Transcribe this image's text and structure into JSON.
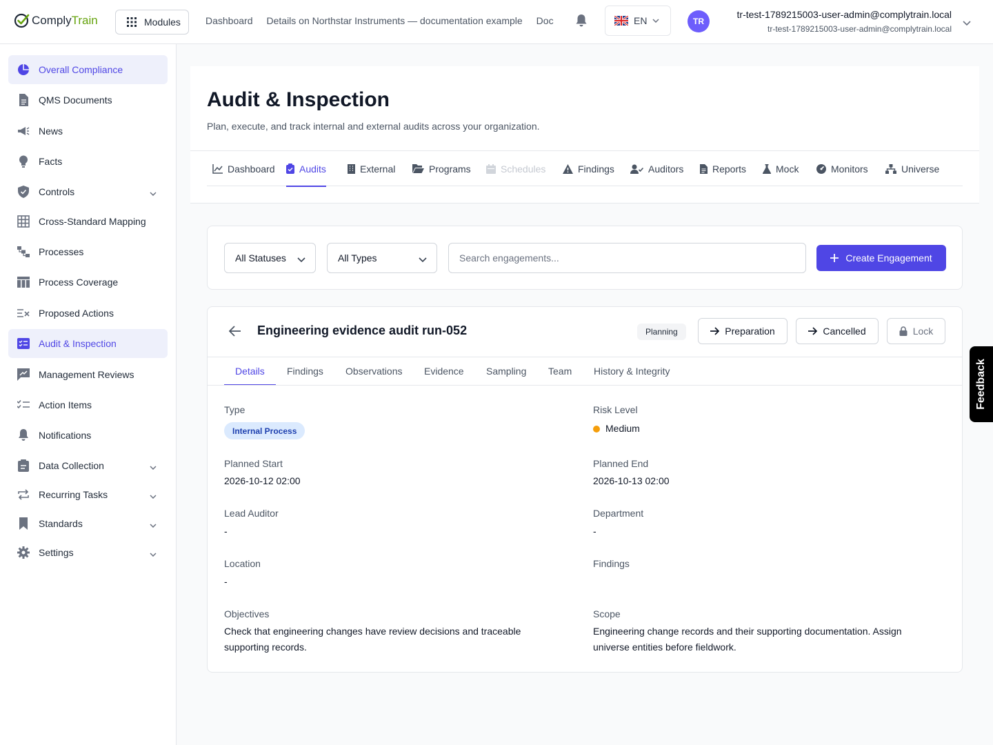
{
  "app": {
    "logo_part1": "Comply",
    "logo_part2": "Train"
  },
  "topbar": {
    "modules_label": "Modules",
    "breadcrumbs": [
      "Dashboard",
      "Details on Northstar Instruments — documentation example",
      "Doc"
    ],
    "language": "EN",
    "avatar_initials": "TR",
    "user_name": "tr-test-1789215003-user-admin@complytrain.local",
    "user_email": "tr-test-1789215003-user-admin@complytrain.local"
  },
  "sidebar": {
    "items": [
      {
        "label": "Overall Compliance",
        "icon": "pie-chart-icon"
      },
      {
        "label": "QMS Documents",
        "icon": "document-icon"
      },
      {
        "label": "News",
        "icon": "megaphone-icon"
      },
      {
        "label": "Facts",
        "icon": "lightbulb-icon"
      },
      {
        "label": "Controls",
        "icon": "shield-icon"
      },
      {
        "label": "Cross-Standard Mapping",
        "icon": "grid-icon"
      },
      {
        "label": "Processes",
        "icon": "flow-icon"
      },
      {
        "label": "Process Coverage",
        "icon": "table-icon"
      },
      {
        "label": "Proposed Actions",
        "icon": "checklist-x-icon"
      },
      {
        "label": "Audit & Inspection",
        "icon": "audit-list-icon"
      },
      {
        "label": "Management Reviews",
        "icon": "chat-chart-icon"
      },
      {
        "label": "Action Items",
        "icon": "checklist-icon"
      },
      {
        "label": "Notifications",
        "icon": "bell-icon"
      },
      {
        "label": "Data Collection",
        "icon": "clipboard-icon"
      },
      {
        "label": "Recurring Tasks",
        "icon": "repeat-icon"
      },
      {
        "label": "Standards",
        "icon": "bookmark-icon"
      },
      {
        "label": "Settings",
        "icon": "gear-icon"
      }
    ]
  },
  "page": {
    "title": "Audit & Inspection",
    "subtitle": "Plan, execute, and track internal and external audits across your organization."
  },
  "module_tabs": [
    "Dashboard",
    "Audits",
    "External",
    "Programs",
    "Schedules",
    "Findings",
    "Auditors",
    "Reports",
    "Mock",
    "Monitors",
    "Universe"
  ],
  "filters": {
    "status_value": "All Statuses",
    "type_value": "All Types",
    "search_placeholder": "Search engagements...",
    "create_label": "Create Engagement"
  },
  "engagement": {
    "title": "Engineering evidence audit run-052",
    "status": "Planning",
    "actions": [
      "Preparation",
      "Cancelled",
      "Lock"
    ],
    "tabs": [
      "Details",
      "Findings",
      "Observations",
      "Evidence",
      "Sampling",
      "Team",
      "History & Integrity"
    ],
    "fields": {
      "type_label": "Type",
      "type_value": "Internal Process",
      "risk_label": "Risk Level",
      "risk_value": "Medium",
      "planned_start_label": "Planned Start",
      "planned_start_value": "2026-10-12 02:00",
      "planned_end_label": "Planned End",
      "planned_end_value": "2026-10-13 02:00",
      "lead_auditor_label": "Lead Auditor",
      "lead_auditor_value": "-",
      "department_label": "Department",
      "department_value": "-",
      "location_label": "Location",
      "location_value": "-",
      "findings_label": "Findings",
      "objectives_label": "Objectives",
      "objectives_value": "Check that engineering changes have review decisions and traceable supporting records.",
      "scope_label": "Scope",
      "scope_value": "Engineering change records and their supporting documentation. Assign universe entities before fieldwork."
    }
  },
  "feedback_label": "Feedback",
  "colors": {
    "accent": "#4f46e5",
    "brand_green": "#65a30d",
    "risk_medium": "#f59e0b",
    "type_pill_bg": "#dbeafe"
  }
}
